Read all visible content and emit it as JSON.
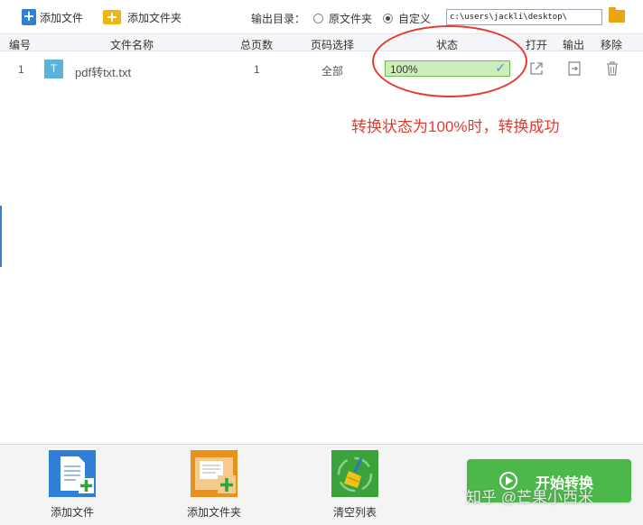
{
  "toolbar": {
    "add_file": "添加文件",
    "add_folder": "添加文件夹",
    "output_dir_label": "输出目录：",
    "radio_original": "原文件夹",
    "radio_custom": "自定义",
    "output_path": "c:\\users\\jackli\\desktop\\"
  },
  "table": {
    "headers": {
      "no": "编号",
      "name": "文件名称",
      "pages": "总页数",
      "page_select": "页码选择",
      "status": "状态",
      "open": "打开",
      "output": "输出",
      "remove": "移除"
    },
    "rows": [
      {
        "no": "1",
        "type_letter": "T",
        "name": "pdf转txt.txt",
        "pages": "1",
        "page_select": "全部",
        "progress_text": "100%",
        "progress_percent": 100
      }
    ]
  },
  "annotation": {
    "text": "转换状态为100%时，转换成功",
    "color": "#e53a2e"
  },
  "footer": {
    "add_file": "添加文件",
    "add_folder": "添加文件夹",
    "clear_list": "清空列表",
    "start": "开始转换"
  },
  "watermark": "知乎 @芒果小西米",
  "colors": {
    "accent_blue": "#2d7fd8",
    "folder_yellow": "#f0b515",
    "start_green": "#4cb84a",
    "progress_green": "#d2f0c4"
  },
  "icons": {
    "open": "external-link-icon",
    "output": "export-icon",
    "remove": "trash-icon"
  }
}
